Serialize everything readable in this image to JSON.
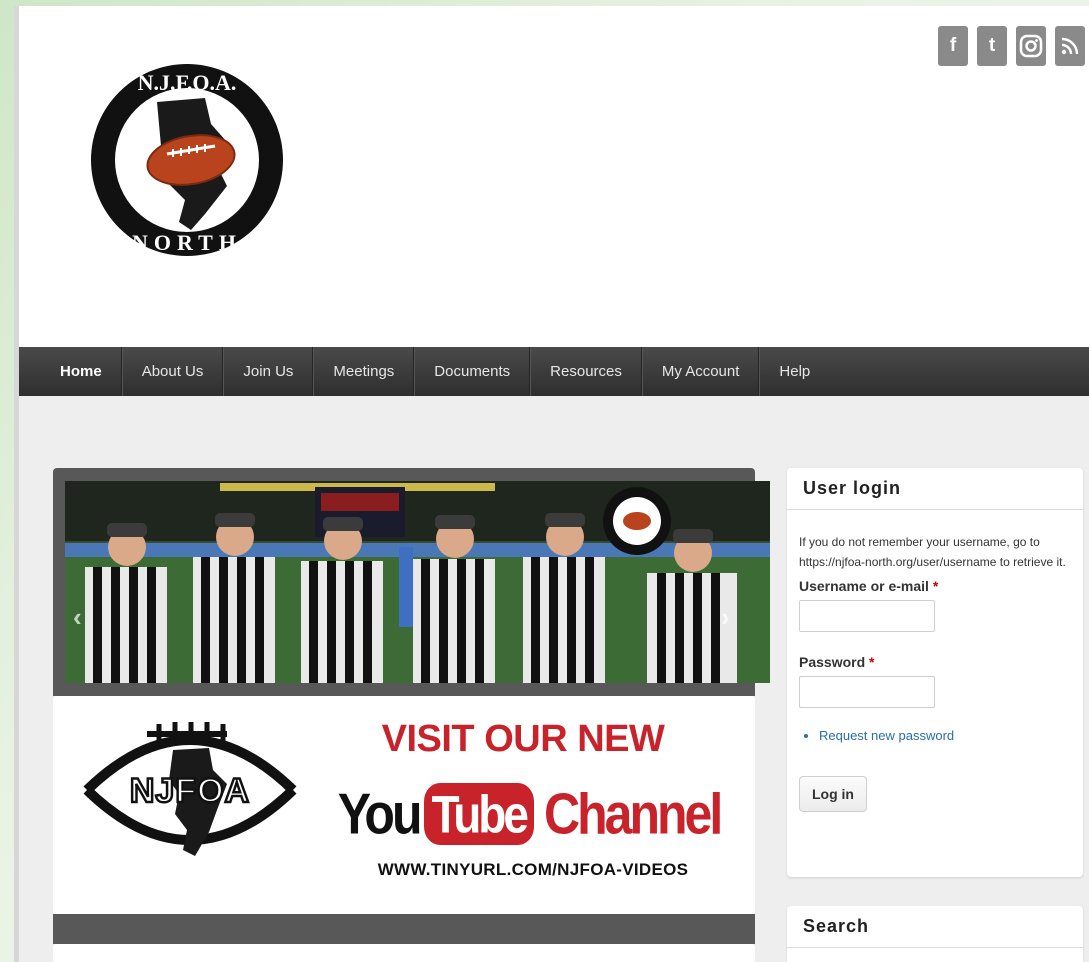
{
  "social": [
    "facebook-icon",
    "twitter-icon",
    "instagram-icon",
    "rss-icon"
  ],
  "nav": [
    {
      "label": "Home",
      "active": true
    },
    {
      "label": "About Us"
    },
    {
      "label": "Join Us"
    },
    {
      "label": "Meetings"
    },
    {
      "label": "Documents"
    },
    {
      "label": "Resources"
    },
    {
      "label": "My Account"
    },
    {
      "label": "Help"
    }
  ],
  "logo": {
    "top_text": "N.J.F.O.A.",
    "bottom_text": "NORTH"
  },
  "promo": {
    "logo_text": "NJFOA",
    "headline": "VISIT OUR NEW",
    "yt_you": "You",
    "yt_tube": "Tube",
    "yt_channel": "Channel",
    "url": "WWW.TINYURL.COM/NJFOA-VIDEOS"
  },
  "login": {
    "title": "User login",
    "hint": "If you do not remember your username, go to https://njfoa-north.org/user/username to retrieve it.",
    "username_label": "Username or e-mail",
    "password_label": "Password",
    "required_mark": "*",
    "request_link": "Request new password",
    "submit": "Log in"
  },
  "search": {
    "title": "Search"
  },
  "colors": {
    "brand_red": "#c8222a",
    "nav_bg": "#3a3a3a",
    "link": "#2a6db0"
  }
}
